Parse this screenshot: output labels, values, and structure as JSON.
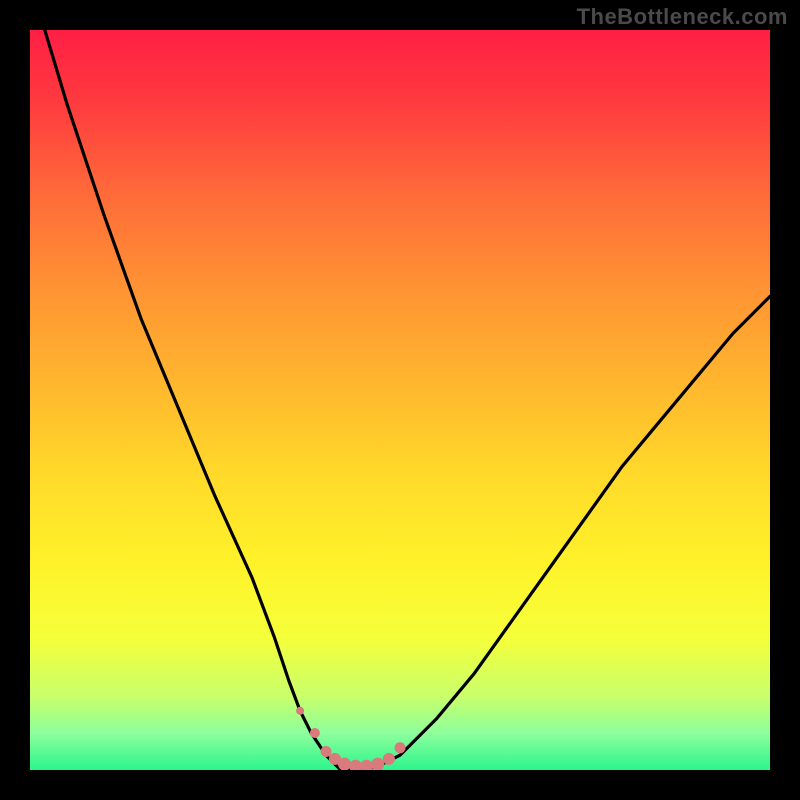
{
  "watermark": {
    "text": "TheBottleneck.com"
  },
  "gradient": {
    "stops": [
      {
        "offset": 0.0,
        "color": "#ff1f44"
      },
      {
        "offset": 0.1,
        "color": "#ff3b3f"
      },
      {
        "offset": 0.22,
        "color": "#ff6a39"
      },
      {
        "offset": 0.35,
        "color": "#ff9333"
      },
      {
        "offset": 0.48,
        "color": "#ffb72e"
      },
      {
        "offset": 0.6,
        "color": "#ffd92a"
      },
      {
        "offset": 0.72,
        "color": "#fff229"
      },
      {
        "offset": 0.82,
        "color": "#f5ff3a"
      },
      {
        "offset": 0.9,
        "color": "#c9ff6a"
      },
      {
        "offset": 0.95,
        "color": "#8dff9c"
      },
      {
        "offset": 1.0,
        "color": "#2cf58c"
      }
    ]
  },
  "colors": {
    "background": "#000000",
    "curve": "#000000",
    "dots": "#d97a7d"
  },
  "chart_data": {
    "type": "line",
    "title": "",
    "xlabel": "",
    "ylabel": "",
    "xlim": [
      0,
      100
    ],
    "ylim": [
      0,
      100
    ],
    "grid": false,
    "legend": false,
    "series": [
      {
        "name": "bottleneck-curve",
        "x": [
          2,
          5,
          10,
          15,
          20,
          25,
          30,
          33,
          35,
          36.5,
          38,
          40,
          41,
          42,
          45,
          47,
          50,
          55,
          60,
          65,
          70,
          75,
          80,
          85,
          90,
          95,
          100
        ],
        "y": [
          100,
          90,
          75,
          61,
          49,
          37,
          26,
          18,
          12,
          8,
          5,
          2,
          1,
          0,
          0,
          0.5,
          2,
          7,
          13,
          20,
          27,
          34,
          41,
          47,
          53,
          59,
          64
        ]
      }
    ],
    "markers": {
      "name": "flat-region-dots",
      "color": "#d97a7d",
      "x": [
        36.5,
        38.5,
        40.0,
        41.2,
        42.5,
        44.0,
        45.5,
        47.0,
        48.5,
        50.0
      ],
      "y": [
        8.0,
        5.0,
        2.5,
        1.5,
        0.8,
        0.5,
        0.5,
        0.8,
        1.5,
        3.0
      ],
      "sizes": [
        4.0,
        5.0,
        5.5,
        6.0,
        6.5,
        6.5,
        6.5,
        6.5,
        6.0,
        5.5
      ]
    }
  }
}
